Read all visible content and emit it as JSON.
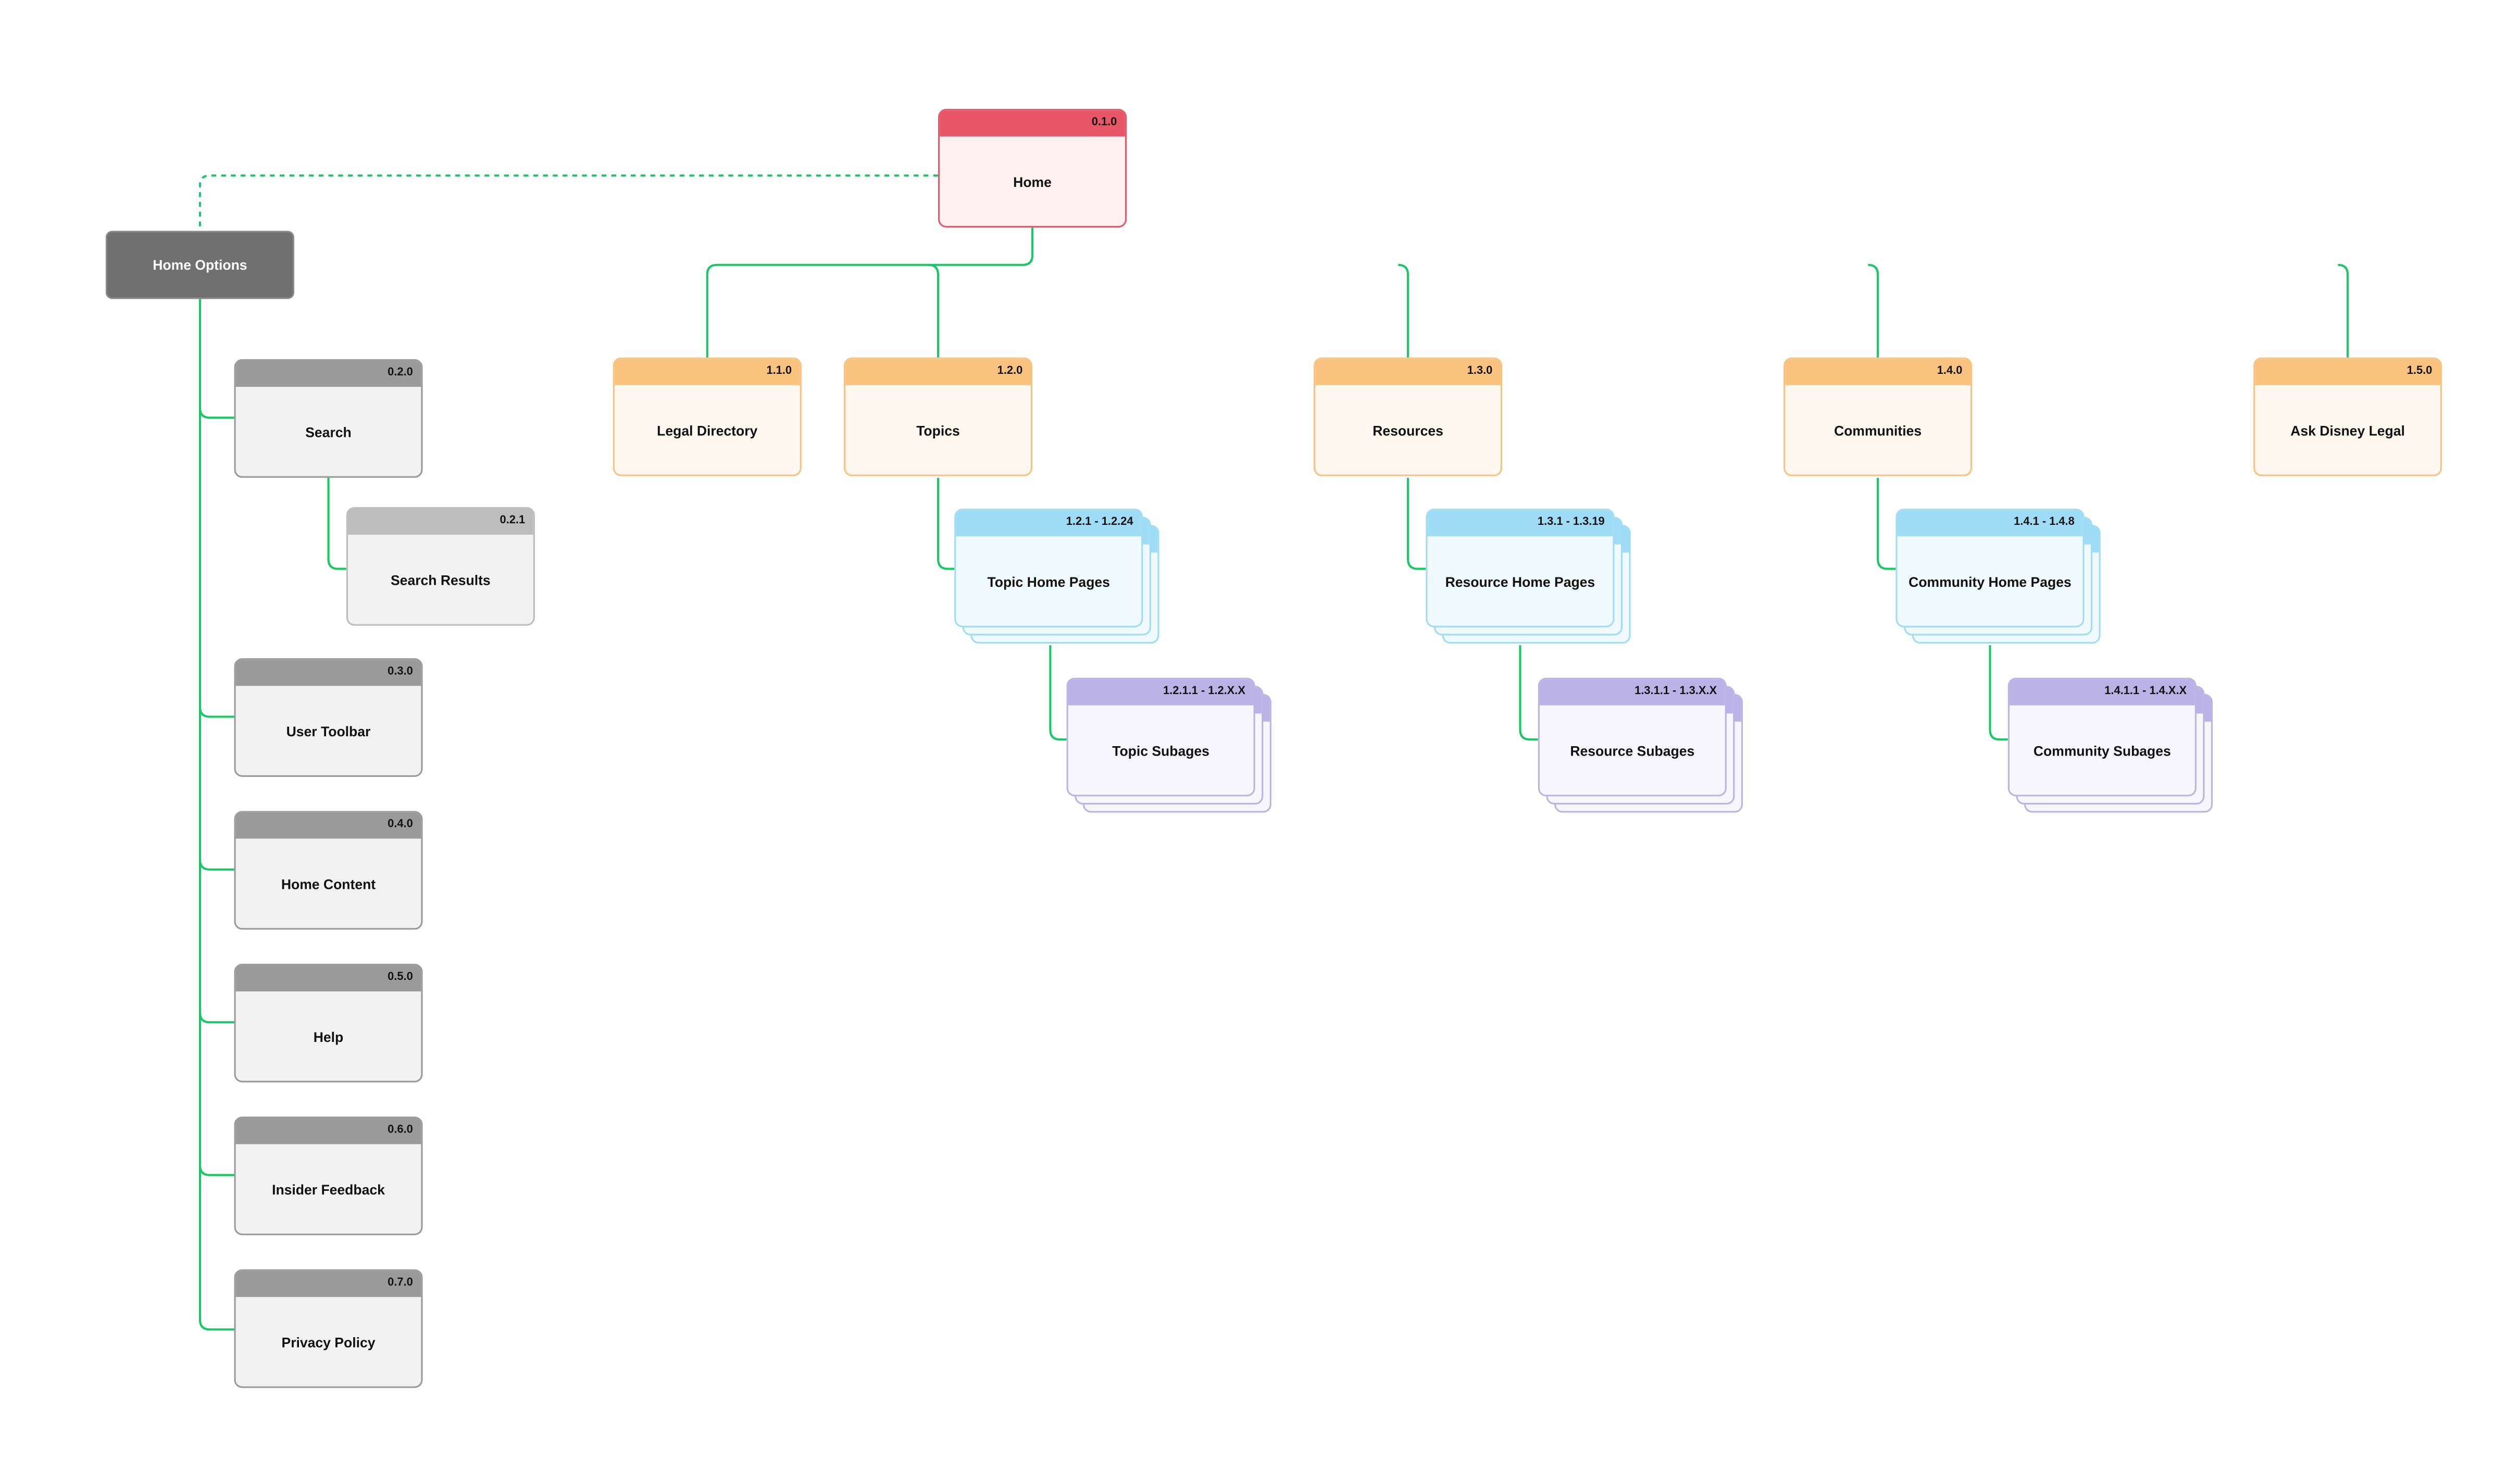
{
  "colors": {
    "connector": "#17c964",
    "home": {
      "header": "#e85768",
      "body": "#fff0f1",
      "border": "#e85768"
    },
    "section": {
      "header": "#f9c27f",
      "body": "#fff8f0",
      "border": "#f9c27f"
    },
    "homepages": {
      "header": "#9fdcf5",
      "body": "#eff9fe",
      "border": "#9fdcf5"
    },
    "subpages": {
      "header": "#bbb2e6",
      "body": "#f7f6fd",
      "border": "#bbb2e6"
    },
    "utility": {
      "header": "#9a9a9a",
      "body": "#f2f2f2",
      "border": "#9a9a9a"
    },
    "utility_light": {
      "header": "#bdbdbd",
      "body": "#f2f2f2",
      "border": "#bdbdbd"
    }
  },
  "home_options": {
    "label": "Home Options"
  },
  "nodes": [
    {
      "id": "0.1.0",
      "label": "Home",
      "style": "home",
      "stacked": false
    },
    {
      "id": "0.2.0",
      "label": "Search",
      "style": "utility",
      "stacked": false
    },
    {
      "id": "0.2.1",
      "label": "Search Results",
      "style": "utility_light",
      "stacked": false
    },
    {
      "id": "0.3.0",
      "label": "User Toolbar",
      "style": "utility",
      "stacked": false
    },
    {
      "id": "0.4.0",
      "label": "Home Content",
      "style": "utility",
      "stacked": false
    },
    {
      "id": "0.5.0",
      "label": "Help",
      "style": "utility",
      "stacked": false
    },
    {
      "id": "0.6.0",
      "label": "Insider Feedback",
      "style": "utility",
      "stacked": false
    },
    {
      "id": "0.7.0",
      "label": "Privacy Policy",
      "style": "utility",
      "stacked": false
    },
    {
      "id": "1.1.0",
      "label": "Legal Directory",
      "style": "section",
      "stacked": false
    },
    {
      "id": "1.2.0",
      "label": "Topics",
      "style": "section",
      "stacked": false
    },
    {
      "id": "1.3.0",
      "label": "Resources",
      "style": "section",
      "stacked": false
    },
    {
      "id": "1.4.0",
      "label": "Communities",
      "style": "section",
      "stacked": false
    },
    {
      "id": "1.5.0",
      "label": "Ask Disney Legal",
      "style": "section",
      "stacked": false
    },
    {
      "id": "1.2.1 - 1.2.24",
      "label": "Topic Home Pages",
      "style": "homepages",
      "stacked": true
    },
    {
      "id": "1.2.1.1 - 1.2.X.X",
      "label": "Topic Subages",
      "style": "subpages",
      "stacked": true
    },
    {
      "id": "1.3.1 - 1.3.19",
      "label": "Resource Home Pages",
      "style": "homepages",
      "stacked": true
    },
    {
      "id": "1.3.1.1 - 1.3.X.X",
      "label": "Resource Subages",
      "style": "subpages",
      "stacked": true
    },
    {
      "id": "1.4.1 - 1.4.8",
      "label": "Community Home Pages",
      "style": "homepages",
      "stacked": true
    },
    {
      "id": "1.4.1.1 - 1.4.X.X",
      "label": "Community Subages",
      "style": "subpages",
      "stacked": true
    }
  ]
}
